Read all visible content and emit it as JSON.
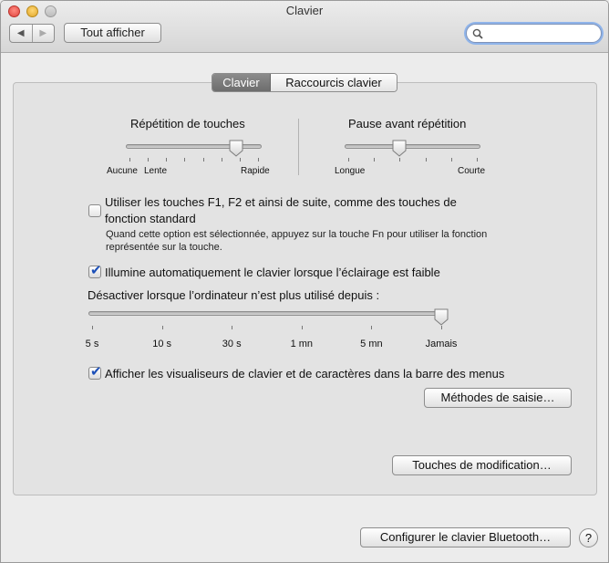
{
  "window": {
    "title": "Clavier"
  },
  "toolbar": {
    "back_icon": "back-arrow-icon",
    "forward_icon": "forward-arrow-icon",
    "show_all_label": "Tout afficher",
    "search": {
      "value": "",
      "placeholder": ""
    }
  },
  "tabs": [
    {
      "label": "Clavier",
      "selected": true
    },
    {
      "label": "Raccourcis clavier",
      "selected": false
    }
  ],
  "key_repeat": {
    "title": "Répétition de touches",
    "min_label": "Aucune",
    "slow_label": "Lente",
    "max_label": "Rapide",
    "value_fraction": 0.83
  },
  "delay_until_repeat": {
    "title": "Pause avant répétition",
    "min_label": "Longue",
    "max_label": "Courte",
    "value_fraction": 0.4
  },
  "fn_keys": {
    "checked": false,
    "label_line1": "Utiliser les touches F1, F2 et ainsi de suite, comme des touches de",
    "label_line2": "fonction standard",
    "help_line1": "Quand cette option est sélectionnée, appuyez sur la touche Fn pour utiliser la fonction",
    "help_line2": "représentée sur la touche."
  },
  "illumination": {
    "checked": true,
    "label": "Illumine automatiquement le clavier lorsque l’éclairage est faible"
  },
  "idle_off": {
    "label": "Désactiver lorsque l’ordinateur n’est plus utilisé depuis :",
    "ticks": [
      "5 s",
      "10 s",
      "30 s",
      "1 mn",
      "5 mn",
      "Jamais"
    ],
    "selected": "Jamais"
  },
  "viewer_menu": {
    "checked": true,
    "label": "Afficher les visualiseurs de clavier et de caractères dans la barre des menus"
  },
  "buttons": {
    "input_methods": "Méthodes de saisie…",
    "modifier_keys": "Touches de modification…",
    "bluetooth": "Configurer le clavier Bluetooth…",
    "help": "?"
  },
  "colors": {
    "accent": "#1b4fb8",
    "tab_active": "#7a7a7a",
    "search_focus": "#8fb4ea"
  }
}
